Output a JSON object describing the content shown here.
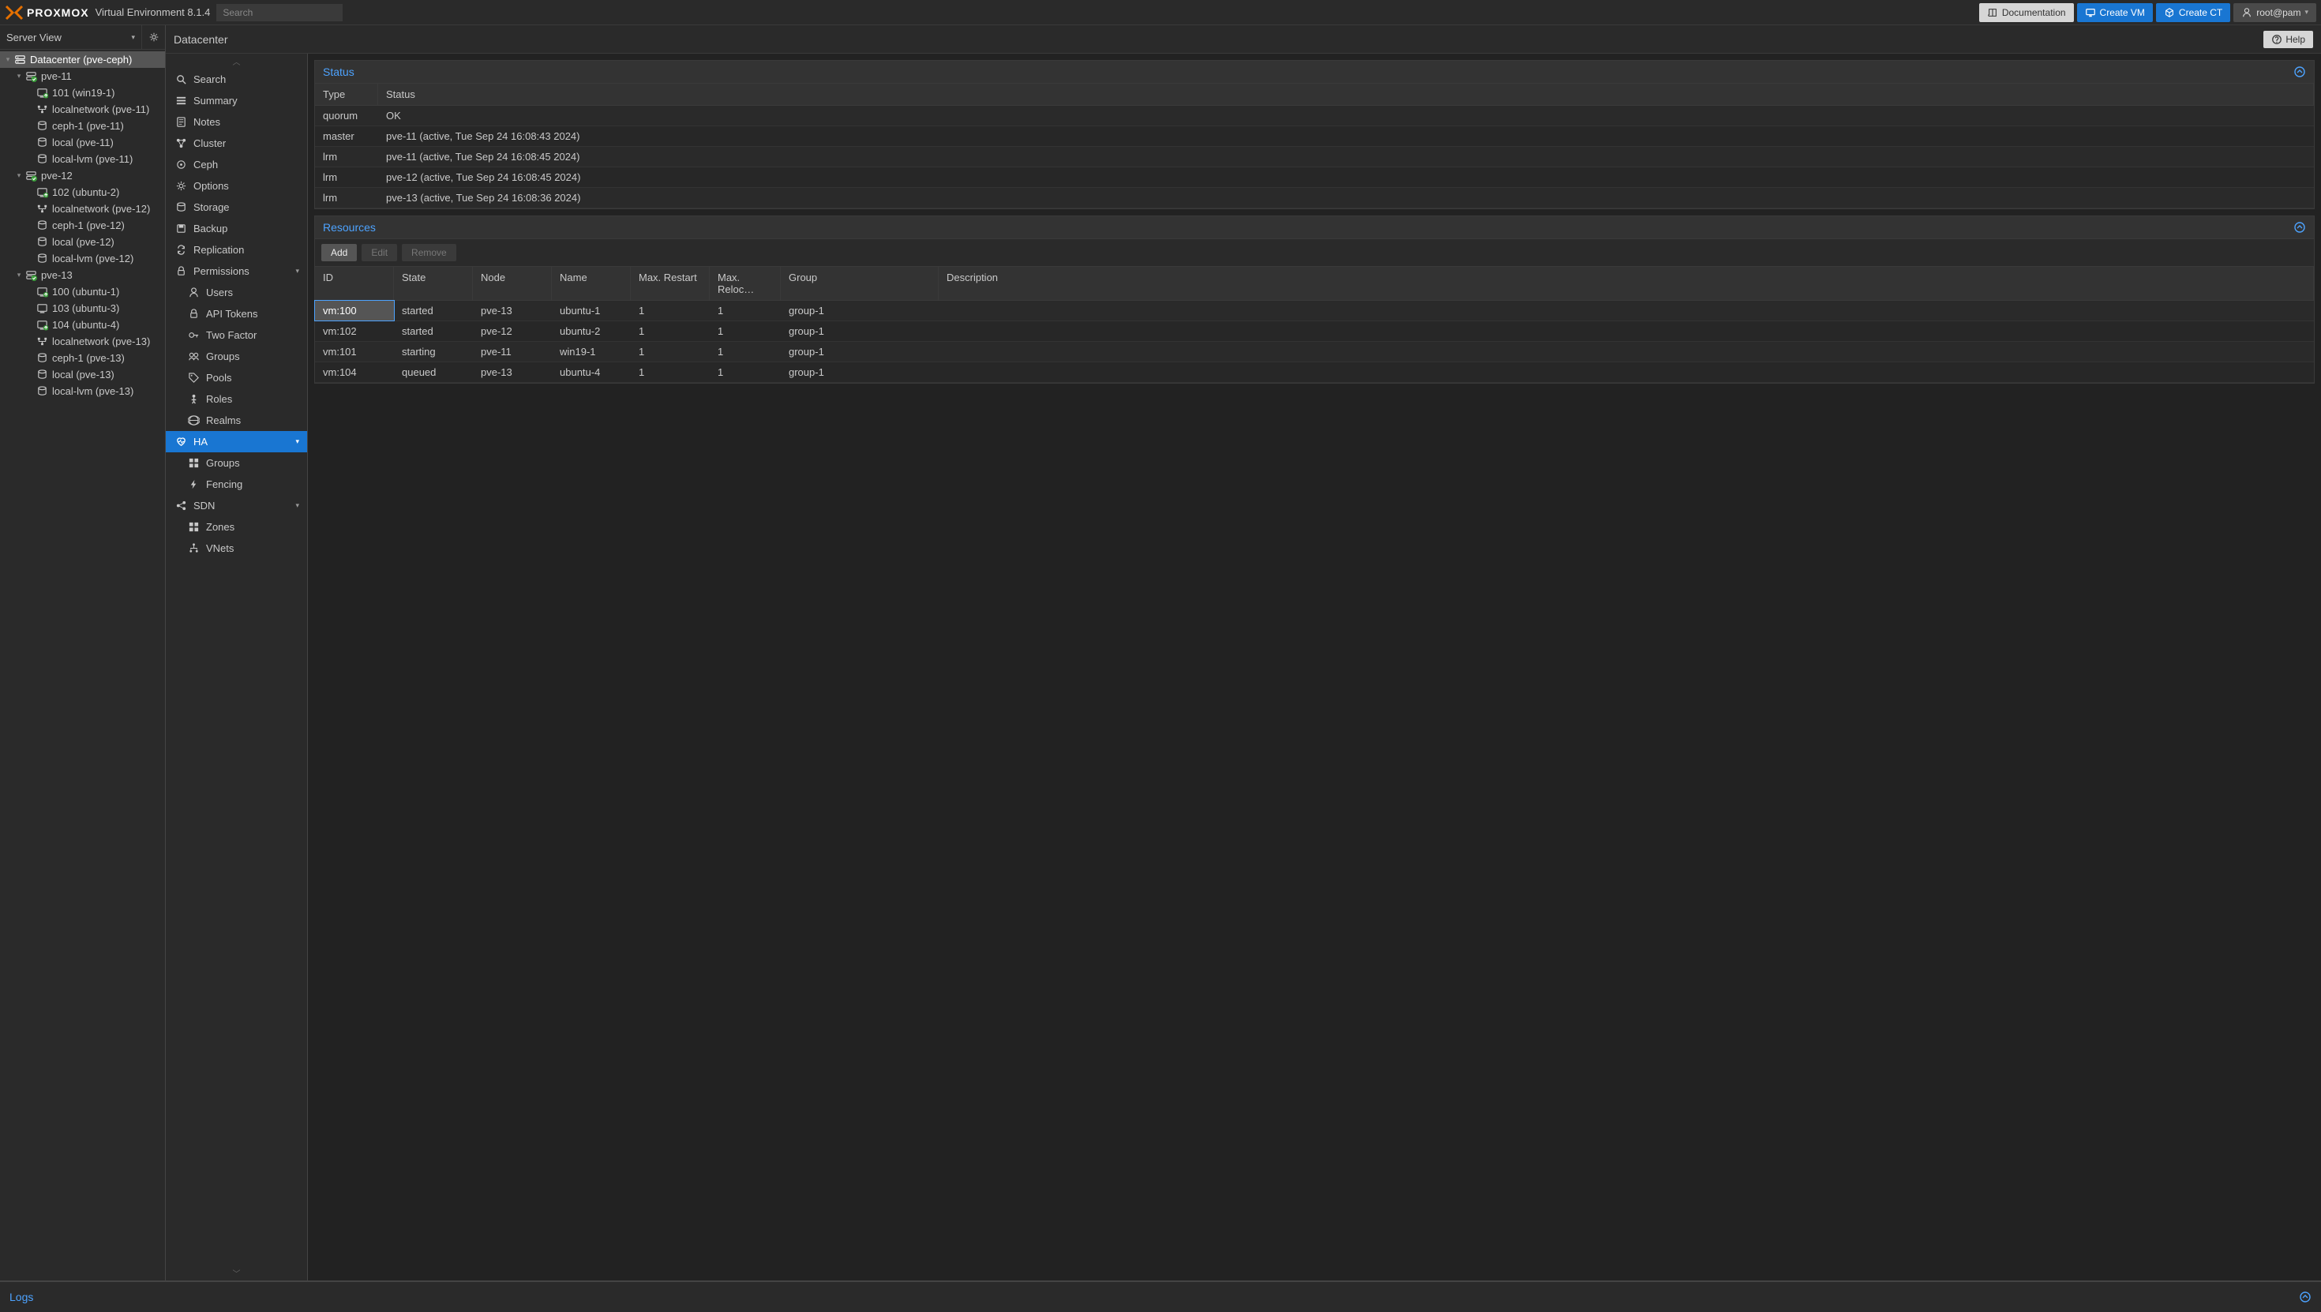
{
  "brand": {
    "name": "PROXMOX",
    "product": "Virtual Environment 8.1.4"
  },
  "search": {
    "placeholder": "Search"
  },
  "header_buttons": {
    "documentation": "Documentation",
    "create_vm": "Create VM",
    "create_ct": "Create CT",
    "user": "root@pam"
  },
  "server_view_label": "Server View",
  "breadcrumb": "Datacenter",
  "help_label": "Help",
  "logs_label": "Logs",
  "tree": {
    "datacenter": "Datacenter (pve-ceph)",
    "nodes": [
      {
        "name": "pve-11",
        "children": [
          {
            "icon": "vm-running",
            "label": "101 (win19-1)"
          },
          {
            "icon": "network",
            "label": "localnetwork (pve-11)"
          },
          {
            "icon": "storage",
            "label": "ceph-1 (pve-11)"
          },
          {
            "icon": "storage",
            "label": "local (pve-11)"
          },
          {
            "icon": "storage",
            "label": "local-lvm (pve-11)"
          }
        ]
      },
      {
        "name": "pve-12",
        "children": [
          {
            "icon": "vm-running",
            "label": "102 (ubuntu-2)"
          },
          {
            "icon": "network",
            "label": "localnetwork (pve-12)"
          },
          {
            "icon": "storage",
            "label": "ceph-1 (pve-12)"
          },
          {
            "icon": "storage",
            "label": "local (pve-12)"
          },
          {
            "icon": "storage",
            "label": "local-lvm (pve-12)"
          }
        ]
      },
      {
        "name": "pve-13",
        "children": [
          {
            "icon": "vm-running",
            "label": "100 (ubuntu-1)"
          },
          {
            "icon": "vm-stopped",
            "label": "103 (ubuntu-3)"
          },
          {
            "icon": "vm-running",
            "label": "104 (ubuntu-4)"
          },
          {
            "icon": "network",
            "label": "localnetwork (pve-13)"
          },
          {
            "icon": "storage",
            "label": "ceph-1 (pve-13)"
          },
          {
            "icon": "storage",
            "label": "local (pve-13)"
          },
          {
            "icon": "storage",
            "label": "local-lvm (pve-13)"
          }
        ]
      }
    ]
  },
  "nav": [
    {
      "icon": "search",
      "label": "Search"
    },
    {
      "icon": "list",
      "label": "Summary"
    },
    {
      "icon": "note",
      "label": "Notes"
    },
    {
      "icon": "cluster",
      "label": "Cluster"
    },
    {
      "icon": "ceph",
      "label": "Ceph"
    },
    {
      "icon": "gear",
      "label": "Options"
    },
    {
      "icon": "disk",
      "label": "Storage"
    },
    {
      "icon": "save",
      "label": "Backup"
    },
    {
      "icon": "replicate",
      "label": "Replication"
    },
    {
      "icon": "lock",
      "label": "Permissions",
      "expandable": true,
      "sub": [
        {
          "icon": "user",
          "label": "Users"
        },
        {
          "icon": "lock",
          "label": "API Tokens"
        },
        {
          "icon": "key",
          "label": "Two Factor"
        },
        {
          "icon": "group",
          "label": "Groups"
        },
        {
          "icon": "tag",
          "label": "Pools"
        },
        {
          "icon": "person",
          "label": "Roles"
        },
        {
          "icon": "globe",
          "label": "Realms"
        }
      ]
    },
    {
      "icon": "heart",
      "label": "HA",
      "active": true,
      "expandable": true,
      "sub": [
        {
          "icon": "grid",
          "label": "Groups"
        },
        {
          "icon": "bolt",
          "label": "Fencing"
        }
      ]
    },
    {
      "icon": "sdn",
      "label": "SDN",
      "expandable": true,
      "sub": [
        {
          "icon": "grid",
          "label": "Zones"
        },
        {
          "icon": "tree",
          "label": "VNets"
        }
      ]
    }
  ],
  "status_panel": {
    "title": "Status",
    "headers": {
      "type": "Type",
      "status": "Status"
    },
    "rows": [
      {
        "type": "quorum",
        "status": "OK"
      },
      {
        "type": "master",
        "status": "pve-11 (active, Tue Sep 24 16:08:43 2024)"
      },
      {
        "type": "lrm",
        "status": "pve-11 (active, Tue Sep 24 16:08:45 2024)"
      },
      {
        "type": "lrm",
        "status": "pve-12 (active, Tue Sep 24 16:08:45 2024)"
      },
      {
        "type": "lrm",
        "status": "pve-13 (active, Tue Sep 24 16:08:36 2024)"
      }
    ]
  },
  "resources_panel": {
    "title": "Resources",
    "toolbar": {
      "add": "Add",
      "edit": "Edit",
      "remove": "Remove"
    },
    "headers": {
      "id": "ID",
      "state": "State",
      "node": "Node",
      "name": "Name",
      "max_restart": "Max. Restart",
      "max_relocate": "Max. Reloc…",
      "group": "Group",
      "description": "Description"
    },
    "rows": [
      {
        "id": "vm:100",
        "state": "started",
        "node": "pve-13",
        "name": "ubuntu-1",
        "max_restart": "1",
        "max_relocate": "1",
        "group": "group-1",
        "description": "",
        "selected": true
      },
      {
        "id": "vm:102",
        "state": "started",
        "node": "pve-12",
        "name": "ubuntu-2",
        "max_restart": "1",
        "max_relocate": "1",
        "group": "group-1",
        "description": ""
      },
      {
        "id": "vm:101",
        "state": "starting",
        "node": "pve-11",
        "name": "win19-1",
        "max_restart": "1",
        "max_relocate": "1",
        "group": "group-1",
        "description": ""
      },
      {
        "id": "vm:104",
        "state": "queued",
        "node": "pve-13",
        "name": "ubuntu-4",
        "max_restart": "1",
        "max_relocate": "1",
        "group": "group-1",
        "description": ""
      }
    ]
  }
}
